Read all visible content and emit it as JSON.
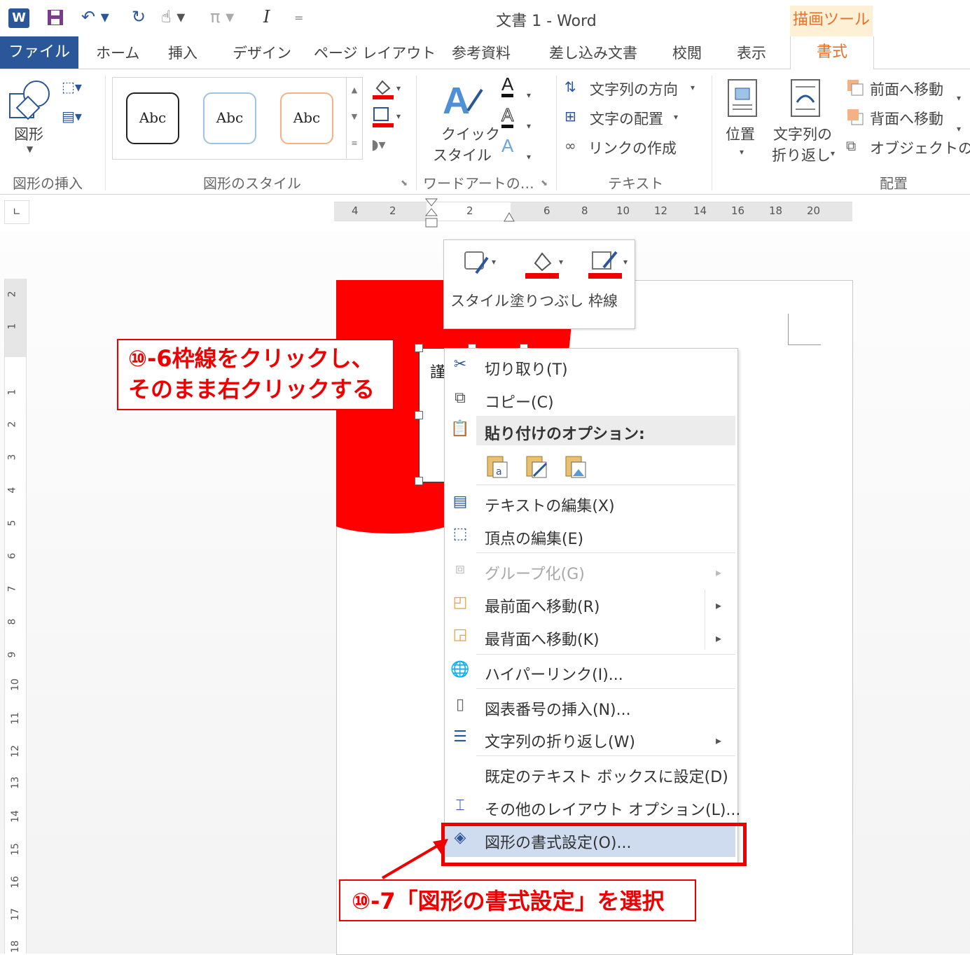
{
  "window": {
    "title": "文書 1 - Word",
    "context_tab": "描画ツール"
  },
  "quick_access": {
    "pi_glyph": "π",
    "italic_glyph": "I"
  },
  "tabs": {
    "file": "ファイル",
    "items": [
      "ホーム",
      "挿入",
      "デザイン",
      "ページ レイアウト",
      "参考資料",
      "差し込み文書",
      "校閲",
      "表示"
    ],
    "active": "書式"
  },
  "ribbon": {
    "insert_shapes": {
      "label": "図形",
      "group": "図形の挿入"
    },
    "shape_styles": {
      "samples": [
        "Abc",
        "Abc",
        "Abc"
      ],
      "group": "図形のスタイル"
    },
    "wordart": {
      "quick_style_1": "クイック",
      "quick_style_2": "スタイル",
      "group": "ワードアートの…"
    },
    "text": {
      "direction": "文字列の方向",
      "align": "文字の配置",
      "link": "リンクの作成",
      "group": "テキスト"
    },
    "arrange": {
      "position": "位置",
      "wrap_1": "文字列の",
      "wrap_2": "折り返し",
      "bring_forward": "前面へ移動",
      "send_backward": "背面へ移動",
      "selection": "オブジェクトの選",
      "group": "配置"
    }
  },
  "ruler": {
    "horizontal": [
      "4",
      "2",
      "2",
      "6",
      "8",
      "10",
      "12",
      "14",
      "16",
      "18",
      "20"
    ],
    "vertical": [
      "2",
      "1",
      "1",
      "2",
      "3",
      "4",
      "5",
      "6",
      "7",
      "8",
      "9",
      "10",
      "11",
      "12",
      "13",
      "14",
      "15",
      "16",
      "17",
      "18"
    ]
  },
  "mini_toolbar": {
    "style": "スタイル",
    "fill": "塗りつぶし",
    "outline": "枠線"
  },
  "document": {
    "textbox_fragment": "謹"
  },
  "context_menu": {
    "cut": "切り取り(T)",
    "copy": "コピー(C)",
    "paste_options": "貼り付けのオプション:",
    "edit_text": "テキストの編集(X)",
    "edit_points": "頂点の編集(E)",
    "group": "グループ化(G)",
    "bring_to_front": "最前面へ移動(R)",
    "send_to_back": "最背面へ移動(K)",
    "hyperlink": "ハイパーリンク(I)...",
    "insert_caption": "図表番号の挿入(N)...",
    "wrap_text": "文字列の折り返し(W)",
    "set_default": "既定のテキスト ボックスに設定(D)",
    "more_layout": "その他のレイアウト オプション(L)...",
    "format_shape": "図形の書式設定(O)..."
  },
  "annotations": {
    "step6_line1": "⑩-6枠線をクリックし、",
    "step6_line2": "そのまま右クリックする",
    "step7": "⑩-7「図形の書式設定」を選択"
  },
  "colors": {
    "accent": "#2b579a",
    "context": "#e6712c",
    "red": "#ff0000",
    "highlight": "#cfdcf0"
  }
}
